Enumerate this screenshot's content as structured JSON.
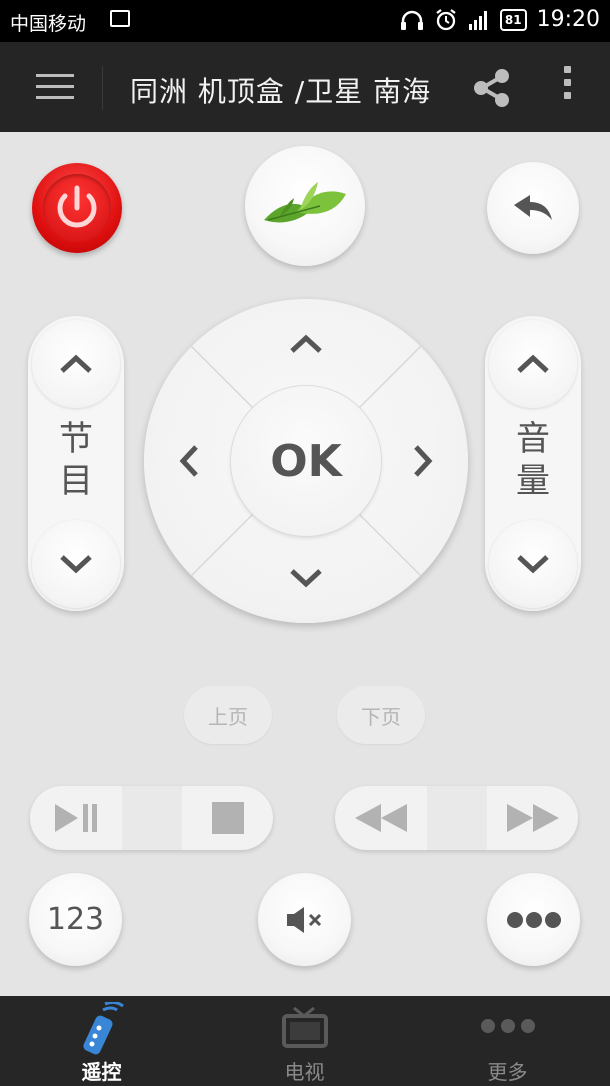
{
  "status_bar": {
    "carrier": "中国移动",
    "battery": "81",
    "time": "19:20"
  },
  "app_bar": {
    "title": "同洲 机顶盒 /卫星 南海"
  },
  "remote": {
    "channel_label": "节\n目",
    "volume_label": "音\n量",
    "ok_label": "OK",
    "page_up": "上页",
    "page_down": "下页",
    "number_label": "123"
  },
  "tabs": [
    {
      "label": "遥控",
      "icon": "remote-icon",
      "active": true
    },
    {
      "label": "电视",
      "icon": "tv-icon",
      "active": false
    },
    {
      "label": "更多",
      "icon": "more-dots-icon",
      "active": false
    }
  ],
  "colors": {
    "accent": "#3a86d6",
    "power": "#e01010",
    "tabbar": "#262626"
  }
}
